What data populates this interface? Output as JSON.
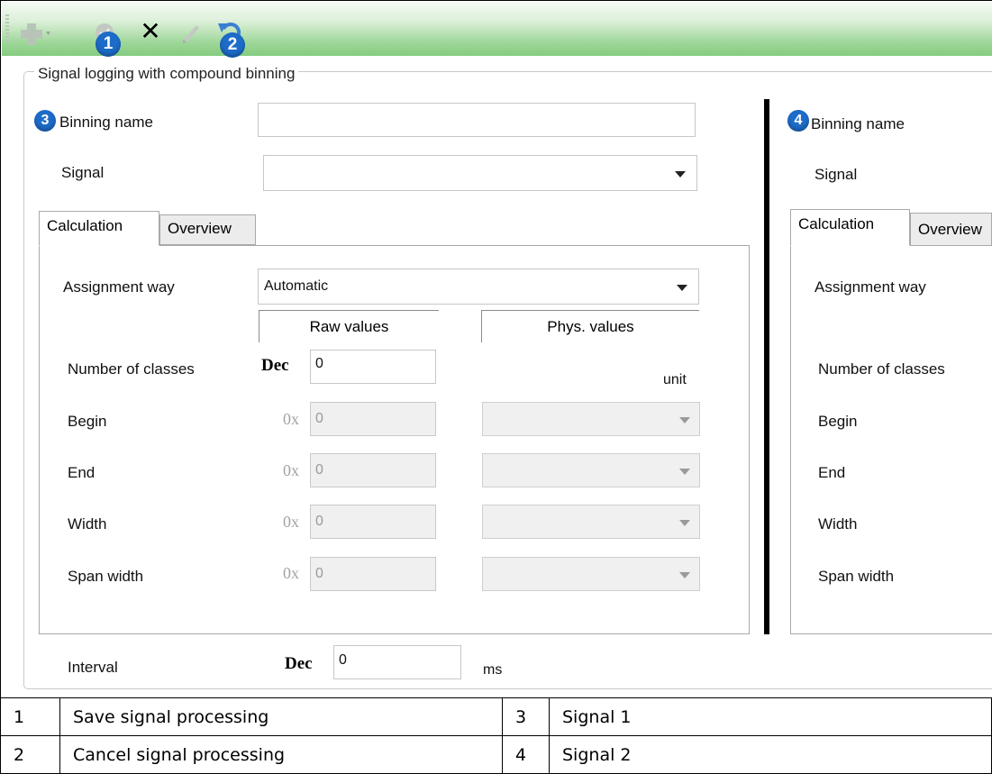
{
  "toolbar": {
    "icons": [
      "add-icon",
      "save-icon",
      "delete-icon",
      "edit-icon",
      "undo-icon"
    ],
    "delete_glyph": "✕",
    "markers": {
      "m1": "1",
      "m2": "2"
    }
  },
  "group": {
    "title": "Signal logging with compound binning"
  },
  "left": {
    "marker": "3",
    "binning_name_label": "Binning name",
    "binning_name_value": "",
    "signal_label": "Signal",
    "signal_value": "",
    "tabs": [
      "Calculation",
      "Overview"
    ],
    "assignment_label": "Assignment way",
    "assignment_value": "Automatic",
    "raw_header": "Raw values",
    "phys_header": "Phys. values",
    "unit_label": "unit",
    "rows": [
      {
        "label": "Number of classes",
        "prefix": "Dec",
        "value": "0"
      },
      {
        "label": "Begin",
        "prefix": "0x",
        "value": "0"
      },
      {
        "label": "End",
        "prefix": "0x",
        "value": "0"
      },
      {
        "label": "Width",
        "prefix": "0x",
        "value": "0"
      },
      {
        "label": "Span width",
        "prefix": "0x",
        "value": "0"
      }
    ],
    "interval_label": "Interval",
    "interval_prefix": "Dec",
    "interval_value": "0",
    "interval_unit": "ms"
  },
  "right": {
    "marker": "4",
    "binning_name_label": "Binning name",
    "signal_label": "Signal",
    "tabs": [
      "Calculation",
      "Overview"
    ],
    "assignment_label": "Assignment way",
    "rows": [
      "Number of classes",
      "Begin",
      "End",
      "Width",
      "Span width"
    ]
  },
  "legend": [
    {
      "n1": "1",
      "t1": "Save signal processing",
      "n2": "3",
      "t2": "Signal 1"
    },
    {
      "n1": "2",
      "t1": "Cancel signal processing",
      "n2": "4",
      "t2": "Signal 2"
    }
  ]
}
